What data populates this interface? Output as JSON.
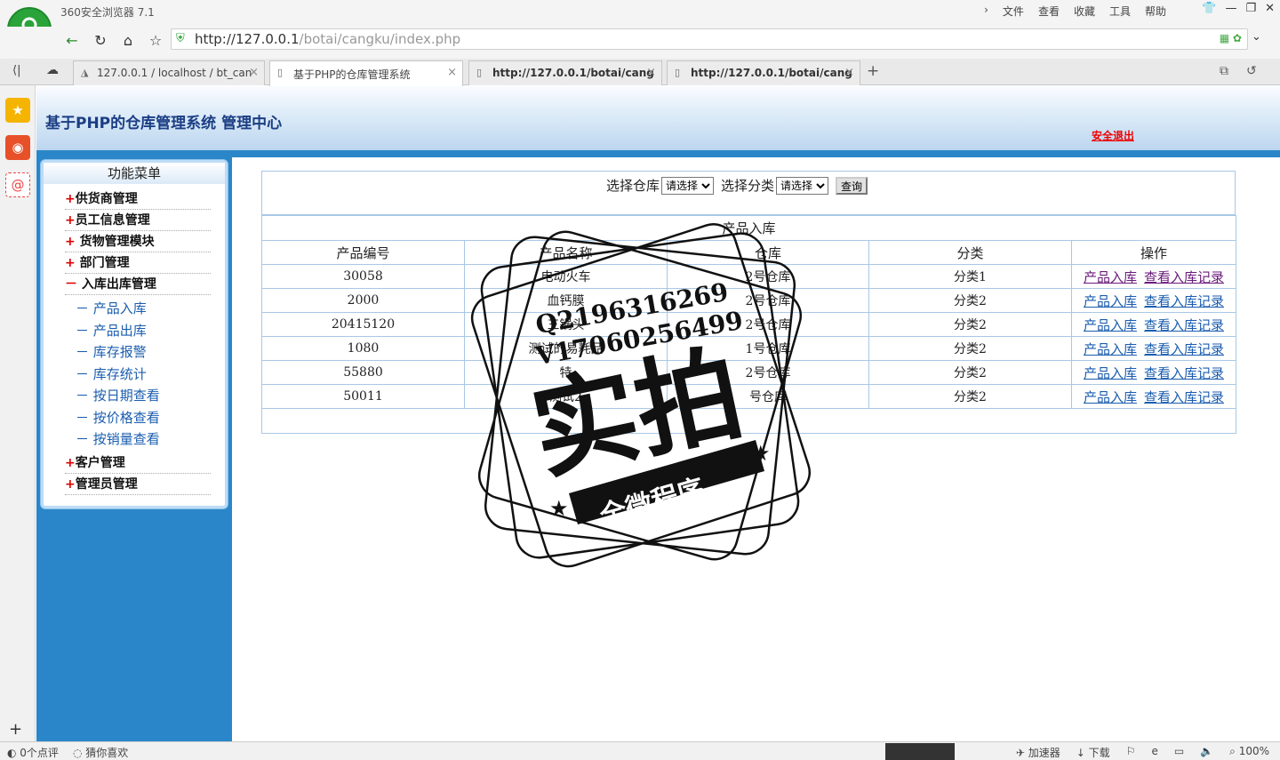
{
  "browser": {
    "name": "360安全浏览器 7.1",
    "menus": [
      "文件",
      "查看",
      "收藏",
      "工具",
      "帮助"
    ],
    "url_host": "http://127.0.0.1",
    "url_path": "/botai/cangku/index.php",
    "tabs": [
      {
        "label": "127.0.0.1 / localhost / bt_can",
        "bold": false
      },
      {
        "label": "基于PHP的仓库管理系统",
        "bold": false
      },
      {
        "label": "http://127.0.0.1/botai/cang",
        "bold": true
      },
      {
        "label": "http://127.0.0.1/botai/cang",
        "bold": true
      }
    ],
    "status": {
      "comments": "0个点评",
      "guess": "猜你喜欢",
      "accelerator": "加速器",
      "download": "下载",
      "zoom": "100%"
    }
  },
  "header": {
    "title": "基于PHP的仓库管理系统 管理中心",
    "logout": "安全退出"
  },
  "menu": {
    "title": "功能菜单",
    "items_top": [
      {
        "mark": "+",
        "label": "供货商管理"
      },
      {
        "mark": "+",
        "label": "员工信息管理"
      },
      {
        "mark": "+ ",
        "label": "货物管理模块"
      },
      {
        "mark": "+ ",
        "label": "部门管理"
      },
      {
        "mark": "－ ",
        "label": "入库出库管理"
      }
    ],
    "sub_items": [
      {
        "mark": "－",
        "label": "产品入库"
      },
      {
        "mark": "－",
        "label": "产品出库"
      },
      {
        "mark": "－",
        "label": "库存报警"
      },
      {
        "mark": "－",
        "label": "库存统计"
      },
      {
        "mark": "－",
        "label": "按日期查看"
      },
      {
        "mark": "－",
        "label": "按价格查看"
      },
      {
        "mark": "－",
        "label": "按销量查看"
      }
    ],
    "items_bottom": [
      {
        "mark": "+",
        "label": "客户管理"
      },
      {
        "mark": "+",
        "label": "管理员管理"
      }
    ]
  },
  "search": {
    "warehouse_label": "选择仓库",
    "warehouse_value": "请选择",
    "category_label": "选择分类",
    "category_value": "请选择",
    "query_button": "查询"
  },
  "table": {
    "caption": "产品入库",
    "columns": [
      "产品编号",
      "产品名称",
      "仓库",
      "分类",
      "操作"
    ],
    "rows": [
      {
        "id": "30058",
        "name": "电动火车",
        "warehouse": "2号仓库",
        "category": "分类1"
      },
      {
        "id": "2000",
        "name": "血钙膜",
        "warehouse": "2号仓库",
        "category": "分类2"
      },
      {
        "id": "20415120",
        "name": "三锅头",
        "warehouse": "2号仓库",
        "category": "分类2"
      },
      {
        "id": "1080",
        "name": "测试的易耗品",
        "warehouse": "1号仓库",
        "category": "分类2"
      },
      {
        "id": "55880",
        "name": "特",
        "warehouse": "2号仓库",
        "category": "分类2"
      },
      {
        "id": "50011",
        "name": "测试2",
        "warehouse": "号仓库",
        "category": "分类2"
      }
    ],
    "action_in": "产品入库",
    "action_log": "查看入库记录"
  },
  "watermark": {
    "line1": "Q2196316269",
    "line2": "V17060256499",
    "big": "实拍",
    "banner": "全微程序"
  }
}
